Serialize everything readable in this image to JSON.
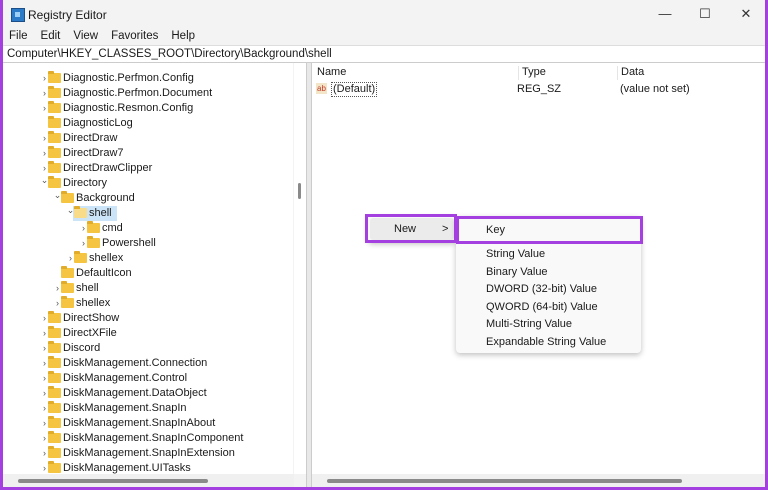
{
  "window": {
    "title": "Registry Editor",
    "controls": [
      "—",
      "☐",
      "✕"
    ]
  },
  "menu": [
    "File",
    "Edit",
    "View",
    "Favorites",
    "Help"
  ],
  "address": "Computer\\HKEY_CLASSES_ROOT\\Directory\\Background\\shell",
  "tree": [
    {
      "label": "Diagnostic.Perfmon.Config",
      "level": 0,
      "exp": "closed"
    },
    {
      "label": "Diagnostic.Perfmon.Document",
      "level": 0,
      "exp": "closed"
    },
    {
      "label": "Diagnostic.Resmon.Config",
      "level": 0,
      "exp": "closed"
    },
    {
      "label": "DiagnosticLog",
      "level": 0,
      "exp": "none"
    },
    {
      "label": "DirectDraw",
      "level": 0,
      "exp": "closed"
    },
    {
      "label": "DirectDraw7",
      "level": 0,
      "exp": "closed"
    },
    {
      "label": "DirectDrawClipper",
      "level": 0,
      "exp": "closed"
    },
    {
      "label": "Directory",
      "level": 0,
      "exp": "open"
    },
    {
      "label": "Background",
      "level": 1,
      "exp": "open"
    },
    {
      "label": "shell",
      "level": 2,
      "exp": "open",
      "selected": true
    },
    {
      "label": "cmd",
      "level": 3,
      "exp": "closed"
    },
    {
      "label": "Powershell",
      "level": 3,
      "exp": "closed"
    },
    {
      "label": "shellex",
      "level": 2,
      "exp": "closed"
    },
    {
      "label": "DefaultIcon",
      "level": 1,
      "exp": "none"
    },
    {
      "label": "shell",
      "level": 1,
      "exp": "closed"
    },
    {
      "label": "shellex",
      "level": 1,
      "exp": "closed"
    },
    {
      "label": "DirectShow",
      "level": 0,
      "exp": "closed"
    },
    {
      "label": "DirectXFile",
      "level": 0,
      "exp": "closed"
    },
    {
      "label": "Discord",
      "level": 0,
      "exp": "closed"
    },
    {
      "label": "DiskManagement.Connection",
      "level": 0,
      "exp": "closed"
    },
    {
      "label": "DiskManagement.Control",
      "level": 0,
      "exp": "closed"
    },
    {
      "label": "DiskManagement.DataObject",
      "level": 0,
      "exp": "closed"
    },
    {
      "label": "DiskManagement.SnapIn",
      "level": 0,
      "exp": "closed"
    },
    {
      "label": "DiskManagement.SnapInAbout",
      "level": 0,
      "exp": "closed"
    },
    {
      "label": "DiskManagement.SnapInComponent",
      "level": 0,
      "exp": "closed"
    },
    {
      "label": "DiskManagement.SnapInExtension",
      "level": 0,
      "exp": "closed"
    },
    {
      "label": "DiskManagement.UITasks",
      "level": 0,
      "exp": "closed"
    }
  ],
  "values": {
    "headers": {
      "name": "Name",
      "type": "Type",
      "data": "Data"
    },
    "rows": [
      {
        "name": "(Default)",
        "type": "REG_SZ",
        "data": "(value not set)",
        "icon": "ab"
      }
    ]
  },
  "context": {
    "new": "New",
    "arrow": ">",
    "submenu": [
      "Key",
      "String Value",
      "Binary Value",
      "DWORD (32-bit) Value",
      "QWORD (64-bit) Value",
      "Multi-String Value",
      "Expandable String Value"
    ]
  },
  "colors": {
    "highlight": "#a43fe0",
    "selection": "#cce4f7"
  }
}
